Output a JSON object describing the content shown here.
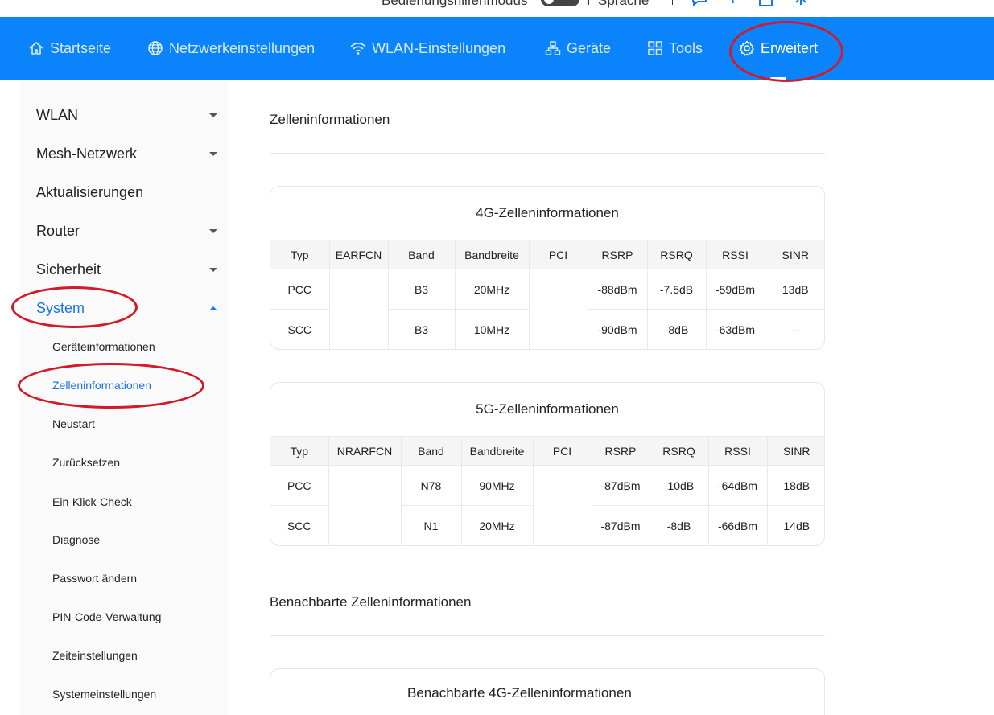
{
  "topbar": {
    "mode_label": "Bedienungshilfenmodus",
    "language_label": "Sprache"
  },
  "nav": {
    "items": [
      {
        "label": "Startseite",
        "icon": "home-icon"
      },
      {
        "label": "Netzwerkeinstellungen",
        "icon": "globe-icon"
      },
      {
        "label": "WLAN-Einstellungen",
        "icon": "wifi-icon"
      },
      {
        "label": "Geräte",
        "icon": "network-devices-icon"
      },
      {
        "label": "Tools",
        "icon": "grid-icon"
      },
      {
        "label": "Erweitert",
        "icon": "gear-icon",
        "active": true
      }
    ]
  },
  "sidebar": {
    "items": [
      {
        "label": "WLAN",
        "expandable": true
      },
      {
        "label": "Mesh-Netzwerk",
        "expandable": true
      },
      {
        "label": "Aktualisierungen",
        "expandable": false
      },
      {
        "label": "Router",
        "expandable": true
      },
      {
        "label": "Sicherheit",
        "expandable": true
      },
      {
        "label": "System",
        "expandable": true,
        "expanded": true,
        "active": true
      }
    ],
    "subitems": [
      {
        "label": "Geräteinformationen"
      },
      {
        "label": "Zelleninformationen",
        "active": true
      },
      {
        "label": "Neustart"
      },
      {
        "label": "Zurücksetzen"
      },
      {
        "label": "Ein-Klick-Check"
      },
      {
        "label": "Diagnose"
      },
      {
        "label": "Passwort ändern"
      },
      {
        "label": "PIN-Code-Verwaltung"
      },
      {
        "label": "Zeiteinstellungen"
      },
      {
        "label": "Systemeinstellungen"
      }
    ]
  },
  "main": {
    "title": "Zelleninformationen",
    "cell4g": {
      "title": "4G-Zelleninformationen",
      "headers": [
        "Typ",
        "EARFCN",
        "Band",
        "Bandbreite",
        "PCI",
        "RSRP",
        "RSRQ",
        "RSSI",
        "SINR"
      ],
      "rows": [
        [
          "PCC",
          "",
          "B3",
          "20MHz",
          "",
          "-88dBm",
          "-7.5dB",
          "-59dBm",
          "13dB"
        ],
        [
          "SCC",
          "",
          "B3",
          "10MHz",
          "",
          "-90dBm",
          "-8dB",
          "-63dBm",
          "--"
        ]
      ]
    },
    "cell5g": {
      "title": "5G-Zelleninformationen",
      "headers": [
        "Typ",
        "NRARFCN",
        "Band",
        "Bandbreite",
        "PCI",
        "RSRP",
        "RSRQ",
        "RSSI",
        "SINR"
      ],
      "rows": [
        [
          "PCC",
          "",
          "N78",
          "90MHz",
          "",
          "-87dBm",
          "-10dB",
          "-64dBm",
          "18dB"
        ],
        [
          "SCC",
          "",
          "N1",
          "20MHz",
          "",
          "-87dBm",
          "-8dB",
          "-66dBm",
          "14dB"
        ]
      ]
    },
    "neighbor_title": "Benachbarte Zelleninformationen",
    "neighbor4g_title": "Benachbarte 4G-Zelleninformationen"
  },
  "colors": {
    "nav_bg": "#0b84fb",
    "accent": "#1a73e8",
    "annotation": "#d11b2a"
  }
}
